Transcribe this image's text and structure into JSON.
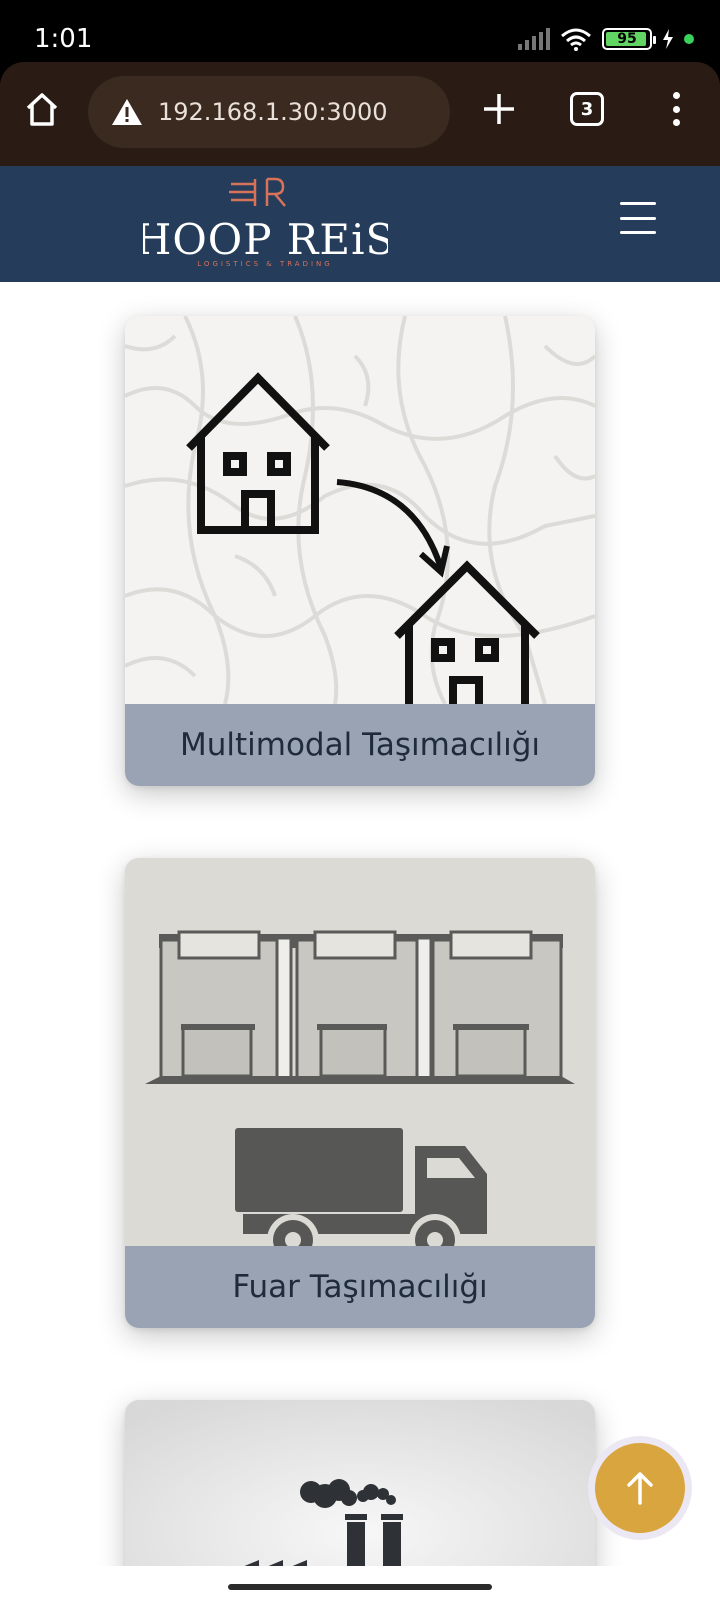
{
  "status_bar": {
    "time": "1:01",
    "battery": "95",
    "battery_color": "#62d463"
  },
  "browser": {
    "url": "192.168.1.30:3000",
    "tab_count": "3",
    "home_icon": "home-icon",
    "warning_icon": "warning-icon",
    "new_tab_icon": "plus-icon",
    "menu_icon": "more-vert-icon"
  },
  "header": {
    "logo_text": "HOOP REiS",
    "logo_tagline": "LOGISTICS & TRADING",
    "logo_monogram": "HR",
    "background": "#253c5a",
    "accent": "#d8735a",
    "menu_icon": "hamburger-icon"
  },
  "services": [
    {
      "label": "Multimodal Taşımacılığı",
      "illustration": "house-relocation-illustration"
    },
    {
      "label": "Fuar Taşımacılığı",
      "illustration": "fair-booths-truck-illustration"
    },
    {
      "label": "",
      "illustration": "factory-illustration"
    }
  ],
  "scroll_top": {
    "icon": "arrow-up-icon",
    "color": "#d9a53e"
  }
}
